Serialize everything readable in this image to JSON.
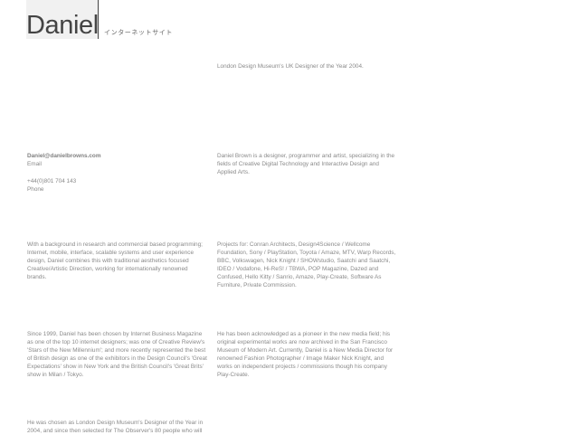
{
  "header": {
    "logo_text": "Daniel",
    "japanese_text": "インターネットサイト"
  },
  "award_line": "London Design Museum's UK Designer of the Year 2004.",
  "contact": {
    "email": "Daniel@danielbrowns.com",
    "email_label": "Email",
    "phone": "+44(0)801 704 143",
    "phone_label": "Phone"
  },
  "paragraphs": {
    "intro": "Daniel Brown is a designer, programmer and artist, specializing in the fields of Creative Digital Technology and Interactive Design and Applied Arts.",
    "background": "With a background in research and commercial based programming; Internet, mobile, interface, scalable systems and user experience design, Daniel combines this with traditional aesthetics focused Creative/Artistic Direction, working for internationally renowned brands.",
    "projects": "Projects for: Conran Architects, Design4Science / Wellcome Foundation, Sony / PlayStation, Toyota / Amaze, MTV, Warp Records, BBC, Volkswagen, Nick Knight / SHOWstudio, Saatchi and Saatchi, IDEO / Vodafone, Hi-ReS! / TBWA, POP Magazine, Dazed and Confused, Hello Kitty / Sanrio, Amaze, Play-Create, Software As Furniture, Private Commission.",
    "since1999": "Since 1999, Daniel has been chosen by Internet Business Magazine as one of the top 10 internet designers; was one of Creative Review's 'Stars of the New Millennium'; and more recently represented the best of British design as one of the exhibitors in the Design Council's 'Great Expectations' show in New York and the British Council's 'Great Brits' show in Milan / Tokyo.",
    "pioneer": "He has been acknowledged as a pioneer in the new media field; his original experimental works are now archived in the San Francisco Museum of Modern Art. Currently, Daniel is a New Media Director for renowned Fashion Photographer / Image Maker Nick Knight, and works on independent projects / commissions though his company Play-Create.",
    "chosen": "He was chosen as London Design Museum's Designer of the Year in 2004, and since then selected for The Observer's 80 people who will"
  }
}
